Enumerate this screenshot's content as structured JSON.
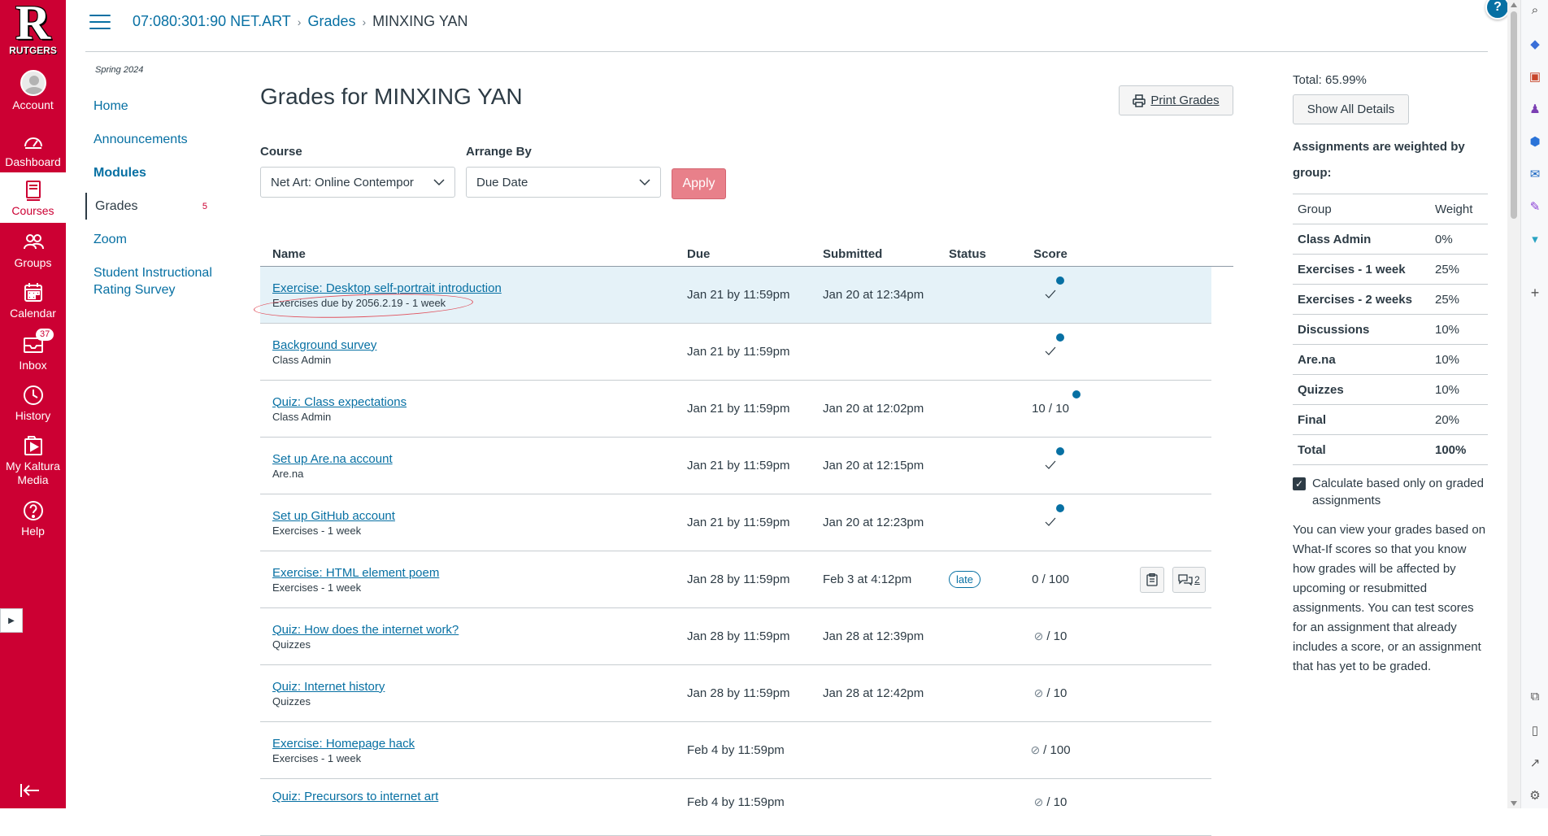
{
  "global_nav": {
    "logo_letter": "R",
    "logo_word": "RUTGERS",
    "items": [
      {
        "label": "Account",
        "icon": "account-icon"
      },
      {
        "label": "Dashboard",
        "icon": "dashboard-icon"
      },
      {
        "label": "Courses",
        "icon": "courses-icon"
      },
      {
        "label": "Groups",
        "icon": "groups-icon"
      },
      {
        "label": "Calendar",
        "icon": "calendar-icon"
      },
      {
        "label": "Inbox",
        "icon": "inbox-icon",
        "badge": "37"
      },
      {
        "label": "History",
        "icon": "history-icon"
      },
      {
        "label": "My Kaltura Media",
        "icon": "kaltura-icon"
      },
      {
        "label": "Help",
        "icon": "help-icon"
      }
    ],
    "colors": {
      "brand": "#cc0033"
    }
  },
  "header": {
    "breadcrumb": [
      "07:080:301:90 NET.ART",
      "Grades",
      "MINXING YAN"
    ],
    "help_glyph": "?"
  },
  "course_nav": {
    "term": "Spring 2024",
    "items": [
      {
        "label": "Home"
      },
      {
        "label": "Announcements"
      },
      {
        "label": "Modules"
      },
      {
        "label": "Grades",
        "badge": "5"
      },
      {
        "label": "Zoom"
      },
      {
        "label": "Student Instructional Rating Survey"
      }
    ]
  },
  "main": {
    "title": "Grades for MINXING YAN",
    "print_label": "Print Grades",
    "course_label": "Course",
    "course_value": "Net Art: Online Contempor",
    "arrange_label": "Arrange By",
    "arrange_value": "Due Date",
    "apply_label": "Apply",
    "columns": [
      "Name",
      "Due",
      "Submitted",
      "Status",
      "Score"
    ],
    "rows": [
      {
        "name": "Exercise: Desktop self-portrait introduction",
        "group": "Exercises due by 2056.2.19 - 1 week",
        "due": "Jan 21 by 11:59pm",
        "submitted": "Jan 20 at 12:34pm",
        "status": "",
        "score": "",
        "score_type": "check"
      },
      {
        "name": "Background survey",
        "group": "Class Admin",
        "due": "Jan 21 by 11:59pm",
        "submitted": "",
        "status": "",
        "score": "",
        "score_type": "check"
      },
      {
        "name": "Quiz: Class expectations",
        "group": "Class Admin",
        "due": "Jan 21 by 11:59pm",
        "submitted": "Jan 20 at 12:02pm",
        "status": "",
        "score": "10 / 10",
        "score_type": "text-dot"
      },
      {
        "name": "Set up Are.na account",
        "group": "Are.na",
        "due": "Jan 21 by 11:59pm",
        "submitted": "Jan 20 at 12:15pm",
        "status": "",
        "score": "",
        "score_type": "check"
      },
      {
        "name": "Set up GitHub account",
        "group": "Exercises - 1 week",
        "due": "Jan 21 by 11:59pm",
        "submitted": "Jan 20 at 12:23pm",
        "status": "",
        "score": "",
        "score_type": "check"
      },
      {
        "name": "Exercise: HTML element poem",
        "group": "Exercises - 1 week",
        "due": "Jan 28 by 11:59pm",
        "submitted": "Feb 3 at 4:12pm",
        "status": "late",
        "score": "0 / 100",
        "score_type": "text",
        "comments": "2"
      },
      {
        "name": "Quiz: How does the internet work?",
        "group": "Quizzes",
        "due": "Jan 28 by 11:59pm",
        "submitted": "Jan 28 at 12:39pm",
        "status": "",
        "score": "/ 10",
        "score_type": "muted"
      },
      {
        "name": "Quiz: Internet history",
        "group": "Quizzes",
        "due": "Jan 28 by 11:59pm",
        "submitted": "Jan 28 at 12:42pm",
        "status": "",
        "score": "/ 10",
        "score_type": "muted"
      },
      {
        "name": "Exercise: Homepage hack",
        "group": "Exercises - 1 week",
        "due": "Feb 4 by 11:59pm",
        "submitted": "",
        "status": "",
        "score": "/ 100",
        "score_type": "muted"
      },
      {
        "name": "Quiz: Precursors to internet art",
        "group": "",
        "due": "Feb 4 by 11:59pm",
        "submitted": "",
        "status": "",
        "score": "/ 10",
        "score_type": "muted"
      }
    ]
  },
  "sidebar": {
    "total": "Total: 65.99%",
    "show_all_label": "Show All Details",
    "weighted_note": "Assignments are weighted by group:",
    "weight_header": {
      "group": "Group",
      "weight": "Weight"
    },
    "weights": [
      {
        "group": "Class Admin",
        "weight": "0%"
      },
      {
        "group": "Exercises - 1 week",
        "weight": "25%"
      },
      {
        "group": "Exercises - 2 weeks",
        "weight": "25%"
      },
      {
        "group": "Discussions",
        "weight": "10%"
      },
      {
        "group": "Are.na",
        "weight": "10%"
      },
      {
        "group": "Quizzes",
        "weight": "10%"
      },
      {
        "group": "Final",
        "weight": "20%"
      },
      {
        "group": "Total",
        "weight": "100%"
      }
    ],
    "calc_label": "Calculate based only on graded assignments",
    "calc_checked": true,
    "whatif_text": "You can view your grades based on What-If scores so that you know how grades will be affected by upcoming or resubmitted assignments. You can test scores for an assignment that already includes a score, or an assignment that has yet to be graded."
  }
}
